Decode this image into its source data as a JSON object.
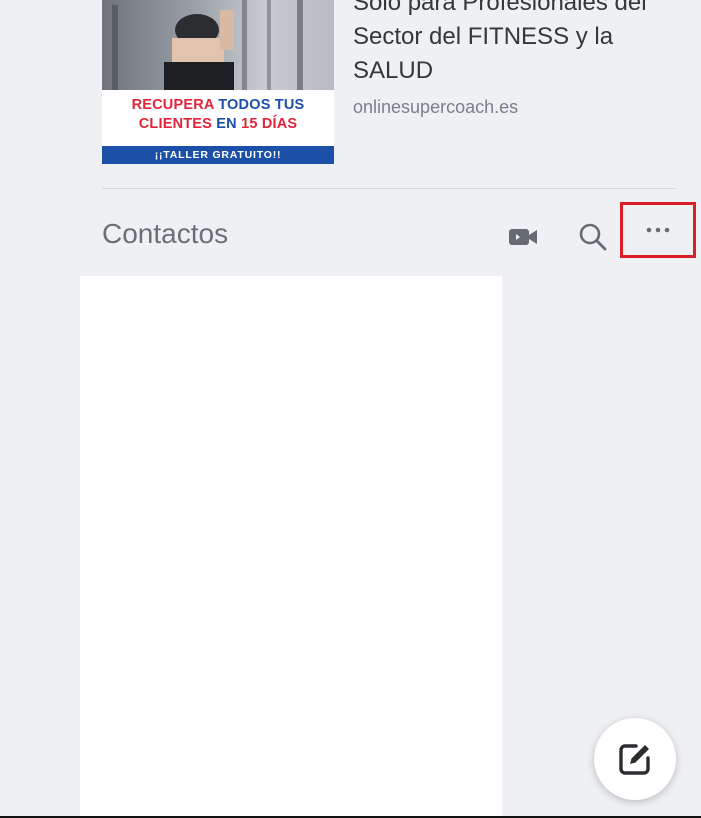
{
  "ad": {
    "headline_lines": [
      "Solo para Profesionales del",
      "Sector del FITNESS y la",
      "SALUD"
    ],
    "url": "onlinesupercoach.es",
    "banner": {
      "line1_red": "RECUPERA",
      "line1_blue": "TODOS TUS",
      "line2_red": "CLIENTES",
      "line2_blue": "EN",
      "line2_red2": "15 DÍAS",
      "strip": "¡¡TALLER GRATUITO!!"
    }
  },
  "contacts": {
    "title": "Contactos",
    "icons": {
      "video": "video-camera-icon",
      "search": "search-icon",
      "more": "more-options-icon"
    },
    "highlight_color": "#d8202a"
  },
  "compose": {
    "icon": "compose-edit-icon"
  }
}
